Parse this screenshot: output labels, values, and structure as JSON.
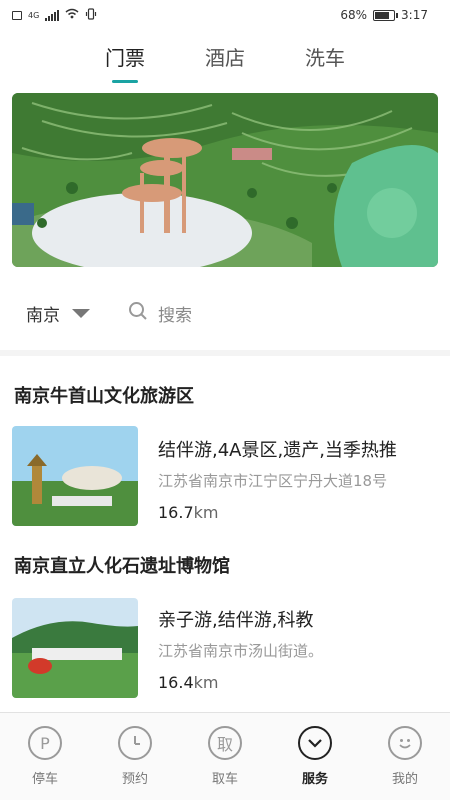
{
  "status_bar": {
    "battery": "68%",
    "time": "3:17",
    "network": "4G"
  },
  "tabs": [
    {
      "label": "门票",
      "active": true
    },
    {
      "label": "酒店",
      "active": false
    },
    {
      "label": "洗车",
      "active": false
    }
  ],
  "search": {
    "city": "南京",
    "placeholder": "搜索"
  },
  "attractions": [
    {
      "name": "南京牛首山文化旅游区",
      "tags": "结伴游,4A景区,遗产,当季热推",
      "address": "江苏省南京市江宁区宁丹大道18号",
      "distance": "16.7",
      "unit": "km"
    },
    {
      "name": "南京直立人化石遗址博物馆",
      "tags": "亲子游,结伴游,科教",
      "address": "江苏省南京市汤山街道。",
      "distance": "16.4",
      "unit": "km"
    }
  ],
  "bottom_nav": [
    {
      "label": "停车",
      "icon_char": "P",
      "icon": "parking-icon",
      "active": false
    },
    {
      "label": "预约",
      "icon_char": "",
      "icon": "clock-icon",
      "active": false
    },
    {
      "label": "取车",
      "icon_char": "取",
      "icon": "pickup-icon",
      "active": false
    },
    {
      "label": "服务",
      "icon_char": "",
      "icon": "chevron-down-circle-icon",
      "active": true
    },
    {
      "label": "我的",
      "icon_char": "",
      "icon": "smiley-icon",
      "active": false
    }
  ],
  "colors": {
    "accent": "#1aa3a3"
  }
}
